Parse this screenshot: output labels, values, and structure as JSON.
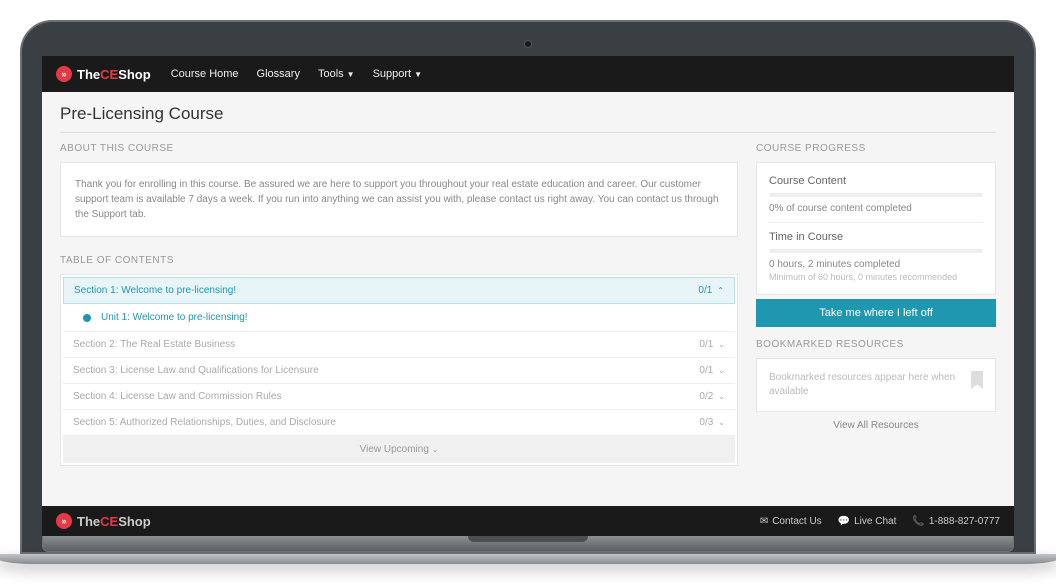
{
  "brand": {
    "the": "The",
    "ce": "CE",
    "shop": "Shop"
  },
  "nav": {
    "home": "Course Home",
    "glossary": "Glossary",
    "tools": "Tools",
    "support": "Support"
  },
  "page_title": "Pre-Licensing Course",
  "about": {
    "label": "ABOUT THIS COURSE",
    "text": "Thank you for enrolling in this course. Be assured we are here to support you throughout your real estate education and career. Our customer support team is available 7 days a week. If you run into anything we can assist you with, please contact us right away. You can contact us through the Support tab."
  },
  "toc": {
    "label": "TABLE OF CONTENTS",
    "sections": [
      {
        "title": "Section 1: Welcome to pre-licensing!",
        "progress": "0/1",
        "unit": "Unit 1: Welcome to pre-licensing!"
      },
      {
        "title": "Section 2: The Real Estate Business",
        "progress": "0/1"
      },
      {
        "title": "Section 3: License Law and Qualifications for Licensure",
        "progress": "0/1"
      },
      {
        "title": "Section 4: License Law and Commission Rules",
        "progress": "0/2"
      },
      {
        "title": "Section 5: Authorized Relationships, Duties, and Disclosure",
        "progress": "0/3"
      }
    ],
    "view_upcoming": "View Upcoming"
  },
  "progress": {
    "label": "COURSE PROGRESS",
    "content_title": "Course Content",
    "content_text": "0% of course content completed",
    "time_title": "Time in Course",
    "time_text": "0 hours, 2 minutes completed",
    "time_sub": "Minimum of 60 hours, 0 minutes recommended",
    "cta": "Take me where I left off"
  },
  "bookmarks": {
    "label": "BOOKMARKED RESOURCES",
    "empty": "Bookmarked resources appear here when available",
    "view_all": "View All Resources"
  },
  "footer": {
    "contact": "Contact Us",
    "chat": "Live Chat",
    "phone": "1-888-827-0777"
  }
}
